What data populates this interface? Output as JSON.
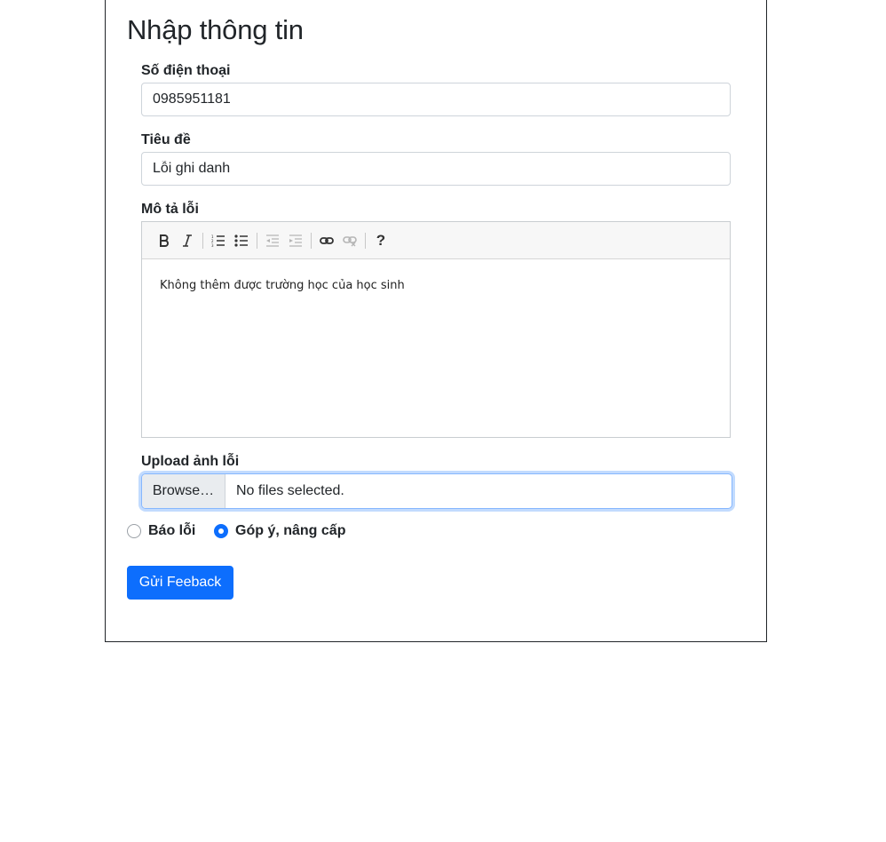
{
  "form": {
    "title": "Nhập thông tin",
    "phone": {
      "label": "Số điện thoại",
      "value": "0985951181"
    },
    "subject": {
      "label": "Tiêu đề",
      "value": "Lỗi ghi danh"
    },
    "description": {
      "label": "Mô tả lỗi",
      "content": "Không thêm được trường học của học sinh",
      "toolbar": [
        "bold-icon",
        "italic-icon",
        "ordered-list-icon",
        "unordered-list-icon",
        "outdent-icon",
        "indent-icon",
        "link-icon",
        "unlink-icon",
        "help-icon"
      ]
    },
    "upload": {
      "label": "Upload ảnh lỗi",
      "button": "Browse…",
      "status": "No files selected."
    },
    "feedback_type": {
      "options": [
        {
          "label": "Báo lỗi",
          "checked": false
        },
        {
          "label": "Góp ý, nâng cấp",
          "checked": true
        }
      ]
    },
    "submit_label": "Gửi Feeback"
  },
  "colors": {
    "primary": "#0d6efd",
    "text": "#212529",
    "border": "#ced4da"
  }
}
